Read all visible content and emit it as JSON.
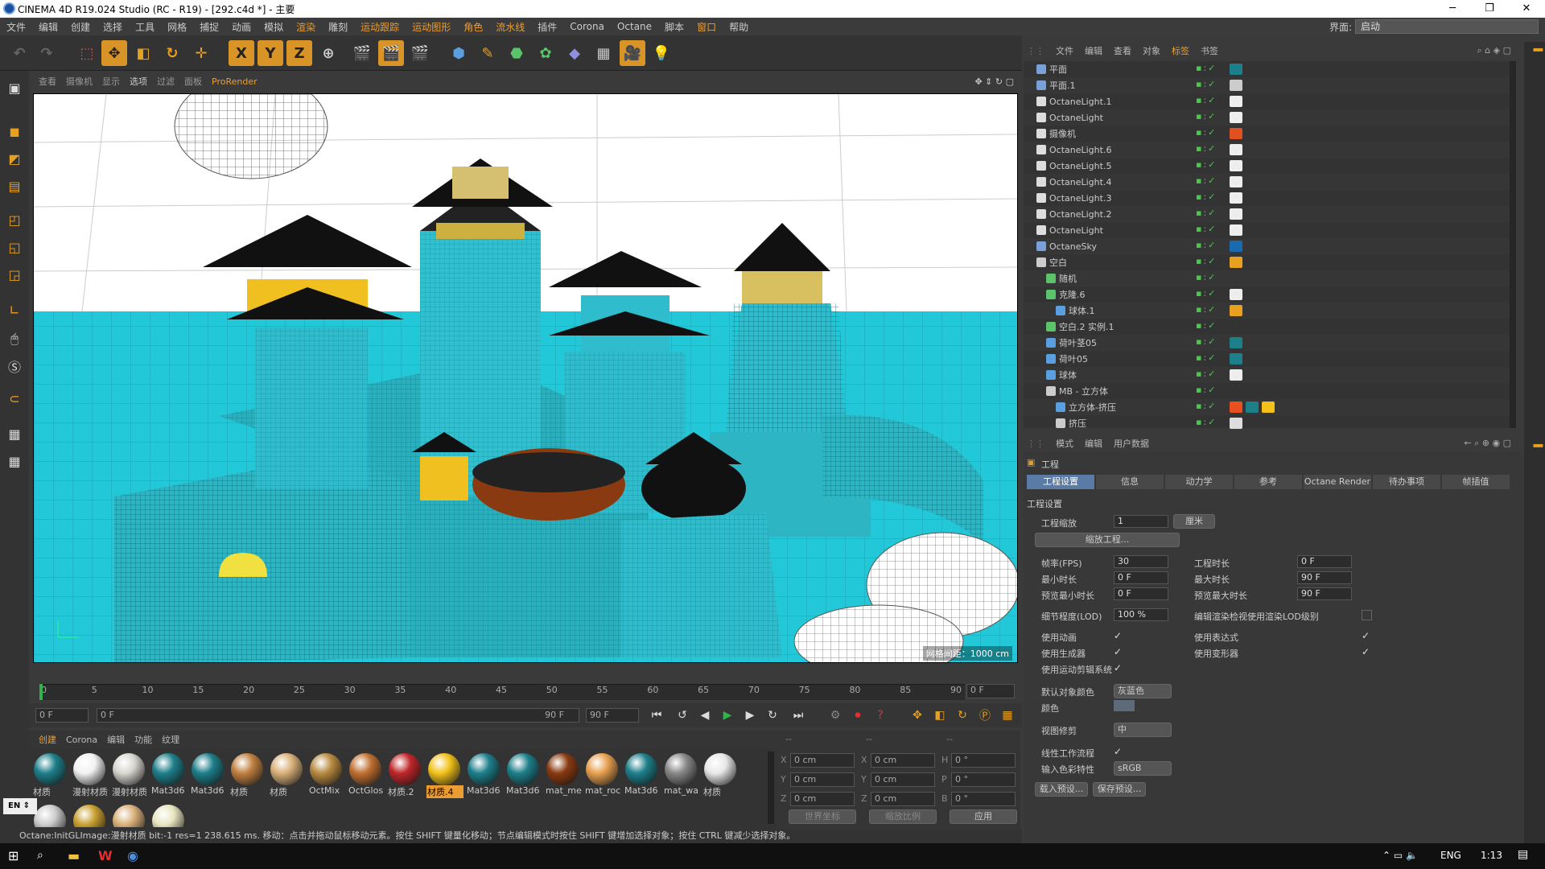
{
  "window": {
    "title": "CINEMA 4D R19.024 Studio (RC - R19) - [292.c4d *] - 主要"
  },
  "menu": [
    "文件",
    "编辑",
    "创建",
    "选择",
    "工具",
    "网格",
    "捕捉",
    "动画",
    "模拟",
    "渲染",
    "雕刻",
    "运动跟踪",
    "运动图形",
    "角色",
    "流水线",
    "插件",
    "Corona",
    "Octane",
    "脚本",
    "窗口",
    "帮助"
  ],
  "interface": {
    "label": "界面:",
    "value": "启动"
  },
  "toolbar": {
    "axis_x": "X",
    "axis_y": "Y",
    "axis_z": "Z"
  },
  "viewport": {
    "menu": [
      "查看",
      "摄像机",
      "显示",
      "选项",
      "过滤",
      "面板",
      "ProRender"
    ],
    "grid_label": "网格间距：1000 cm"
  },
  "timeline": {
    "ticks": [
      "0",
      "5",
      "10",
      "15",
      "20",
      "25",
      "30",
      "35",
      "40",
      "45",
      "50",
      "55",
      "60",
      "65",
      "70",
      "75",
      "80",
      "85",
      "90"
    ],
    "frame_right": "0 F",
    "start": "0 F",
    "range_start": "0 F",
    "range_end": "90 F",
    "end": "90 F",
    "current_frame": 0,
    "max_frame": 90
  },
  "materials": {
    "menu": [
      "创建",
      "Corona",
      "编辑",
      "功能",
      "纹理"
    ],
    "items": [
      {
        "label": "材质",
        "color": "#1d7f8a"
      },
      {
        "label": "漫射材质",
        "color": "#f2f2f2"
      },
      {
        "label": "漫射材质",
        "color": "#d8d6cf"
      },
      {
        "label": "Mat3d6",
        "color": "#1d7f8a"
      },
      {
        "label": "Mat3d6",
        "color": "#1d7f8a"
      },
      {
        "label": "材质",
        "color": "#c08040"
      },
      {
        "label": "材质",
        "color": "#d9b079"
      },
      {
        "label": "OctMix",
        "color": "#b88a40"
      },
      {
        "label": "OctGlos",
        "color": "#c07030"
      },
      {
        "label": "材质.2",
        "color": "#c0262a"
      },
      {
        "label": "材质.4",
        "color": "#f2c21a"
      },
      {
        "label": "Mat3d6",
        "color": "#1d7f8a"
      },
      {
        "label": "Mat3d6",
        "color": "#1d7f8a"
      },
      {
        "label": "mat_me",
        "color": "#8a3a10"
      },
      {
        "label": "mat_roc",
        "color": "#e8a050"
      },
      {
        "label": "Mat3d6",
        "color": "#1d7f8a"
      },
      {
        "label": "mat_wa",
        "color": "#888888"
      },
      {
        "label": "材质",
        "color": "#e8e8e8"
      }
    ],
    "row2_colors": [
      "#cccccc",
      "#c9a030",
      "#d9b079",
      "#e8e6c0"
    ],
    "selected_index": 10
  },
  "coords": {
    "headers": [
      "--",
      "--",
      "--"
    ],
    "rows": [
      {
        "a": "X",
        "av": "0 cm",
        "b": "X",
        "bv": "0 cm",
        "c": "H",
        "cv": "0 °"
      },
      {
        "a": "Y",
        "av": "0 cm",
        "b": "Y",
        "bv": "0 cm",
        "c": "P",
        "cv": "0 °"
      },
      {
        "a": "Z",
        "av": "0 cm",
        "b": "Z",
        "bv": "0 cm",
        "c": "B",
        "cv": "0 °"
      }
    ],
    "world": "世界坐标",
    "scale": "缩放比例",
    "apply": "应用"
  },
  "language": {
    "code": "EN"
  },
  "status": "Octane:InitGLImage:漫射材质  bit:-1 res=1 238.615 ms.   移动：点击并拖动鼠标移动元素。按住 SHIFT 键量化移动；节点编辑模式时按住 SHIFT 键增加选择对象；按住 CTRL 键减少选择对象。",
  "object_manager": {
    "menu": [
      "文件",
      "编辑",
      "查看",
      "对象",
      "标签",
      "书签"
    ],
    "rows": [
      {
        "name": "平面",
        "indent": 0,
        "icon": "#7aa0d8"
      },
      {
        "name": "平面.1",
        "indent": 0,
        "icon": "#7aa0d8"
      },
      {
        "name": "OctaneLight.1",
        "indent": 0,
        "icon": "#ddd"
      },
      {
        "name": "OctaneLight",
        "indent": 0,
        "icon": "#ddd"
      },
      {
        "name": "摄像机",
        "indent": 0,
        "icon": "#ddd"
      },
      {
        "name": "OctaneLight.6",
        "indent": 0,
        "icon": "#ddd"
      },
      {
        "name": "OctaneLight.5",
        "indent": 0,
        "icon": "#ddd"
      },
      {
        "name": "OctaneLight.4",
        "indent": 0,
        "icon": "#ddd"
      },
      {
        "name": "OctaneLight.3",
        "indent": 0,
        "icon": "#ddd"
      },
      {
        "name": "OctaneLight.2",
        "indent": 0,
        "icon": "#ddd"
      },
      {
        "name": "OctaneLight",
        "indent": 0,
        "icon": "#ddd"
      },
      {
        "name": "OctaneSky",
        "indent": 0,
        "icon": "#7aa0d8"
      },
      {
        "name": "空白",
        "indent": 0,
        "icon": "#ccc"
      },
      {
        "name": "随机",
        "indent": 1,
        "icon": "#5bc46a"
      },
      {
        "name": "克隆.6",
        "indent": 1,
        "icon": "#5bc46a"
      },
      {
        "name": "球体.1",
        "indent": 2,
        "icon": "#5aa0e0"
      },
      {
        "name": "空白.2 实例.1",
        "indent": 1,
        "icon": "#5bc46a"
      },
      {
        "name": "荷叶茎05",
        "indent": 1,
        "icon": "#5aa0e0"
      },
      {
        "name": "荷叶05",
        "indent": 1,
        "icon": "#5aa0e0"
      },
      {
        "name": "球体",
        "indent": 1,
        "icon": "#5aa0e0"
      },
      {
        "name": "MB - 立方体",
        "indent": 1,
        "icon": "#ccc"
      },
      {
        "name": "立方体-挤压",
        "indent": 2,
        "icon": "#5aa0e0"
      },
      {
        "name": "挤压",
        "indent": 2,
        "icon": "#ccc"
      }
    ]
  },
  "attributes": {
    "menu": [
      "模式",
      "编辑",
      "用户数据"
    ],
    "object": "工程",
    "tabs": [
      "工程设置",
      "信息",
      "动力学",
      "参考",
      "Octane Render",
      "待办事项",
      "帧插值"
    ],
    "section": "工程设置",
    "scale_label": "工程缩放",
    "scale_value": "1",
    "scale_unit": "厘米",
    "scale_btn": "缩放工程...",
    "fps_label": "帧率(FPS)",
    "fps": "30",
    "duration_label": "工程时长",
    "duration": "0 F",
    "min_label": "最小时长",
    "min": "0 F",
    "max_label": "最大时长",
    "max": "90 F",
    "pmin_label": "预览最小时长",
    "pmin": "0 F",
    "pmax_label": "预览最大时长",
    "pmax": "90 F",
    "lod_label": "细节程度(LOD)",
    "lod": "100 %",
    "lod_render_label": "编辑渲染检视使用渲染LOD级别",
    "anim_label": "使用动画",
    "expr_label": "使用表达式",
    "gen_label": "使用生成器",
    "deform_label": "使用变形器",
    "mograph_label": "使用运动剪辑系统",
    "objcolor_label": "默认对象颜色",
    "objcolor": "灰蓝色",
    "color_label": "颜色",
    "clip_label": "视图修剪",
    "clip": "中",
    "linear_label": "线性工作流程",
    "profile_label": "输入色彩特性",
    "profile": "sRGB",
    "load_btn": "载入预设...",
    "save_btn": "保存预设..."
  },
  "taskbar": {
    "lang": "ENG",
    "time": "1:13"
  }
}
